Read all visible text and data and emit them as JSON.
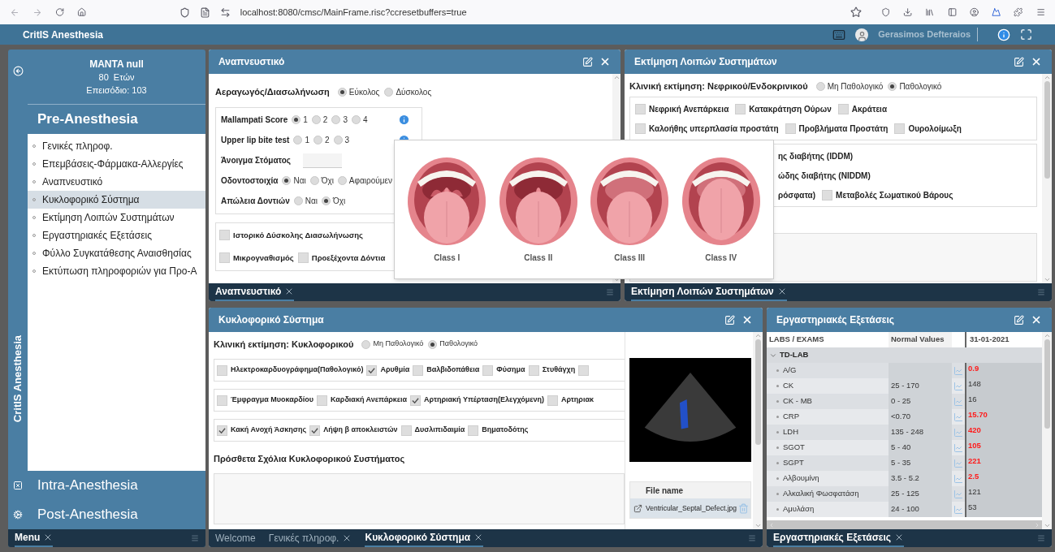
{
  "browser": {
    "url": "localhost:8080/cmsc/MainFrame.risc?ccresetbuffers=true"
  },
  "app": {
    "title": "CritIS Anesthesia",
    "user": "Gerasimos Defteraios"
  },
  "sidebar": {
    "vertical_title": "CritIS Anesthesia",
    "patient": {
      "name": "MANTA null",
      "age": "80  Ετών",
      "episode": "Επεισόδιο: 103"
    },
    "sections": [
      {
        "label": "Pre-Anesthesia",
        "expanded": true,
        "items": [
          {
            "label": "Γενικές πληροφ.",
            "selected": false
          },
          {
            "label": "Επεμβάσεις-Φάρμακα-Αλλεργίες",
            "selected": false
          },
          {
            "label": "Αναπνευστικό",
            "selected": false
          },
          {
            "label": "Κυκλοφορικό Σύστημα",
            "selected": true
          },
          {
            "label": "Εκτίμηση Λοιπών Συστημάτων",
            "selected": false
          },
          {
            "label": "Εργαστηριακές Εξετάσεις",
            "selected": false
          },
          {
            "label": "Φύλλο Συγκατάθεσης Αναισθησίας",
            "selected": false
          },
          {
            "label": "Εκτύπωση πληροφοριών για Προ-Α",
            "selected": false
          }
        ]
      },
      {
        "label": "Intra-Anesthesia",
        "expanded": false
      },
      {
        "label": "Post-Anesthesia",
        "expanded": false
      }
    ],
    "tabs": [
      {
        "label": "Menu",
        "selected": true
      }
    ]
  },
  "respiratory": {
    "title": "Αναπνευστικό",
    "airway": {
      "label": "Αεραγωγός/Διασωλήνωση",
      "options": [
        {
          "label": "Εύκολος",
          "selected": true
        },
        {
          "label": "Δύσκολος",
          "selected": false
        }
      ]
    },
    "rows": [
      {
        "kind": "radio",
        "label": "Mallampati Score",
        "info": true,
        "options": [
          {
            "label": "1",
            "selected": true
          },
          {
            "label": "2",
            "selected": false
          },
          {
            "label": "3",
            "selected": false
          },
          {
            "label": "4",
            "selected": false
          }
        ]
      },
      {
        "kind": "radio",
        "label": "Upper lip bite test",
        "info": true,
        "options": [
          {
            "label": "1",
            "selected": false
          },
          {
            "label": "2",
            "selected": false
          },
          {
            "label": "3",
            "selected": false
          }
        ]
      },
      {
        "kind": "field",
        "label": "Άνοιγμα Στόματος"
      },
      {
        "kind": "radio",
        "label": "Οδοντοστοιχία",
        "info": false,
        "options": [
          {
            "label": "Ναι",
            "selected": true
          },
          {
            "label": "Όχι",
            "selected": false
          },
          {
            "label": "Αφαιρούμεν",
            "selected": false
          }
        ]
      },
      {
        "kind": "radio",
        "label": "Απώλεια Δοντιών",
        "info": false,
        "options": [
          {
            "label": "Ναι",
            "selected": false
          },
          {
            "label": "Όχι",
            "selected": true
          }
        ]
      }
    ],
    "checks": [
      [
        {
          "label": "Ιστορικό Δύσκολης Διασωλήνωσης",
          "checked": false
        }
      ],
      [
        {
          "label": "Μικρογναθισμός",
          "checked": false
        },
        {
          "label": "Προεξέχοντα Δόντια",
          "checked": false
        }
      ]
    ],
    "tabs": [
      {
        "label": "Αναπνευστικό",
        "selected": true
      }
    ]
  },
  "mallampati_popup": {
    "classes": [
      "Class I",
      "Class II",
      "Class III",
      "Class IV"
    ]
  },
  "other_systems": {
    "title": "Εκτίμηση Λοιπών Συστημάτων",
    "assessment": {
      "label": "Κλινική εκτίμηση: Νεφρικού/Ενδοκρινικού",
      "options": [
        {
          "label": "Μη Παθολογικό",
          "selected": false
        },
        {
          "label": "Παθολογικό",
          "selected": true
        }
      ]
    },
    "groups": [
      [
        [
          {
            "label": "Νεφρική Ανεπάρκεια",
            "checked": false
          },
          {
            "label": "Κατακράτηση Ούρων",
            "checked": false
          },
          {
            "label": "Ακράτεια",
            "checked": false
          }
        ],
        [
          {
            "label": "Καλοήθης υπερπλασία προστάτη",
            "checked": false
          },
          {
            "label": "Προβλήματα Προστάτη",
            "checked": false
          },
          {
            "label": "Ουρολοίμωξη",
            "checked": false
          }
        ]
      ],
      [
        [
          {
            "label": "ης διαβήτης (IDDM)"
          }
        ],
        [
          {
            "label": "ώδης διαβήτης (NIDDM)"
          }
        ],
        [
          {
            "label": "ρόσφατα)"
          },
          {
            "label": "Μεταβολές Σωματικού Βάρους",
            "checked": false
          }
        ]
      ]
    ],
    "tabs": [
      {
        "label": "Εκτίμηση Λοιπών Συστημάτων",
        "selected": true
      }
    ]
  },
  "cardio": {
    "title": "Κυκλοφορικό Σύστημα",
    "assessment": {
      "label": "Κλινική εκτίμηση: Κυκλοφορικού",
      "options": [
        {
          "label": "Μη Παθολογικό",
          "selected": false
        },
        {
          "label": "Παθολογικό",
          "selected": true
        }
      ]
    },
    "rows": [
      [
        {
          "label": "Ηλεκτροκαρδυογράφημα(Παθολογικό)",
          "checked": false
        },
        {
          "label": "Αρυθμία",
          "checked": true
        },
        {
          "label": "Βαλβιδοπάθεια",
          "checked": false
        },
        {
          "label": "Φύσημα",
          "checked": false
        },
        {
          "label": "Στυθάγχη",
          "checked": false
        },
        {
          "checked": false
        }
      ],
      [
        {
          "label": "Έμφραγμα Μυοκαρδίου",
          "checked": false
        },
        {
          "label": "Καρδιακή Ανεπάρκεια",
          "checked": false
        },
        {
          "label": "Αρτηριακή Υπέρταση(Ελεγχόμενη)",
          "checked": true
        },
        {
          "label": "Αρτηριακ",
          "checked": false
        }
      ],
      [
        {
          "label": "Κακή Ανοχή Άσκησης",
          "checked": true
        },
        {
          "label": "Λήψη β αποκλειστών",
          "checked": true
        },
        {
          "label": "Δυσλιπιδαιμία",
          "checked": false
        },
        {
          "label": "Βηματοδότης",
          "checked": false
        }
      ]
    ],
    "notes_label": "Πρόσθετα Σχόλια Κυκλοφορικού Συστήματος",
    "files": {
      "column": "File name",
      "rows": [
        {
          "name": "Ventricular_Septal_Defect.jpg",
          "selected": true
        }
      ]
    },
    "tabs": [
      {
        "label": "Welcome",
        "selected": false,
        "closable": false
      },
      {
        "label": "Γενικές πληροφ.",
        "selected": false,
        "closable": true
      },
      {
        "label": "Κυκλοφορικό Σύστημα",
        "selected": true,
        "closable": true
      }
    ]
  },
  "labs": {
    "title": "Εργαστηριακές Εξετάσεις",
    "columns": [
      "LABS / EXAMS",
      "Normal Values",
      "31-01-2021"
    ],
    "group": {
      "label": "TD-LAB",
      "expanded": true
    },
    "rows": [
      {
        "name": "A/G",
        "value": "0.9",
        "abnormal": true
      },
      {
        "name": "CK",
        "normal": "25 - 170",
        "value": "148",
        "abnormal": false
      },
      {
        "name": "CK - MB",
        "normal": "0 - 25",
        "value": "16",
        "abnormal": false
      },
      {
        "name": "CRP",
        "normal": "<0.70",
        "value": "15.70",
        "abnormal": true
      },
      {
        "name": "LDH",
        "normal": "135 - 248",
        "value": "420",
        "abnormal": true
      },
      {
        "name": "SGOT",
        "normal": "5 - 40",
        "value": "105",
        "abnormal": true
      },
      {
        "name": "SGPT",
        "normal": "5 - 35",
        "value": "221",
        "abnormal": true
      },
      {
        "name": "Αλβουμίνη",
        "normal": "3.5 - 5.2",
        "value": "2.5",
        "abnormal": true
      },
      {
        "name": "Αλκαλική Φωσφατάση",
        "normal": "25 - 125",
        "value": "121",
        "abnormal": false
      },
      {
        "name": "Αμυλάση",
        "normal": "24 - 100",
        "value": "53",
        "abnormal": false
      }
    ],
    "tabs": [
      {
        "label": "Εργαστηριακές Εξετάσεις",
        "selected": true
      }
    ]
  }
}
